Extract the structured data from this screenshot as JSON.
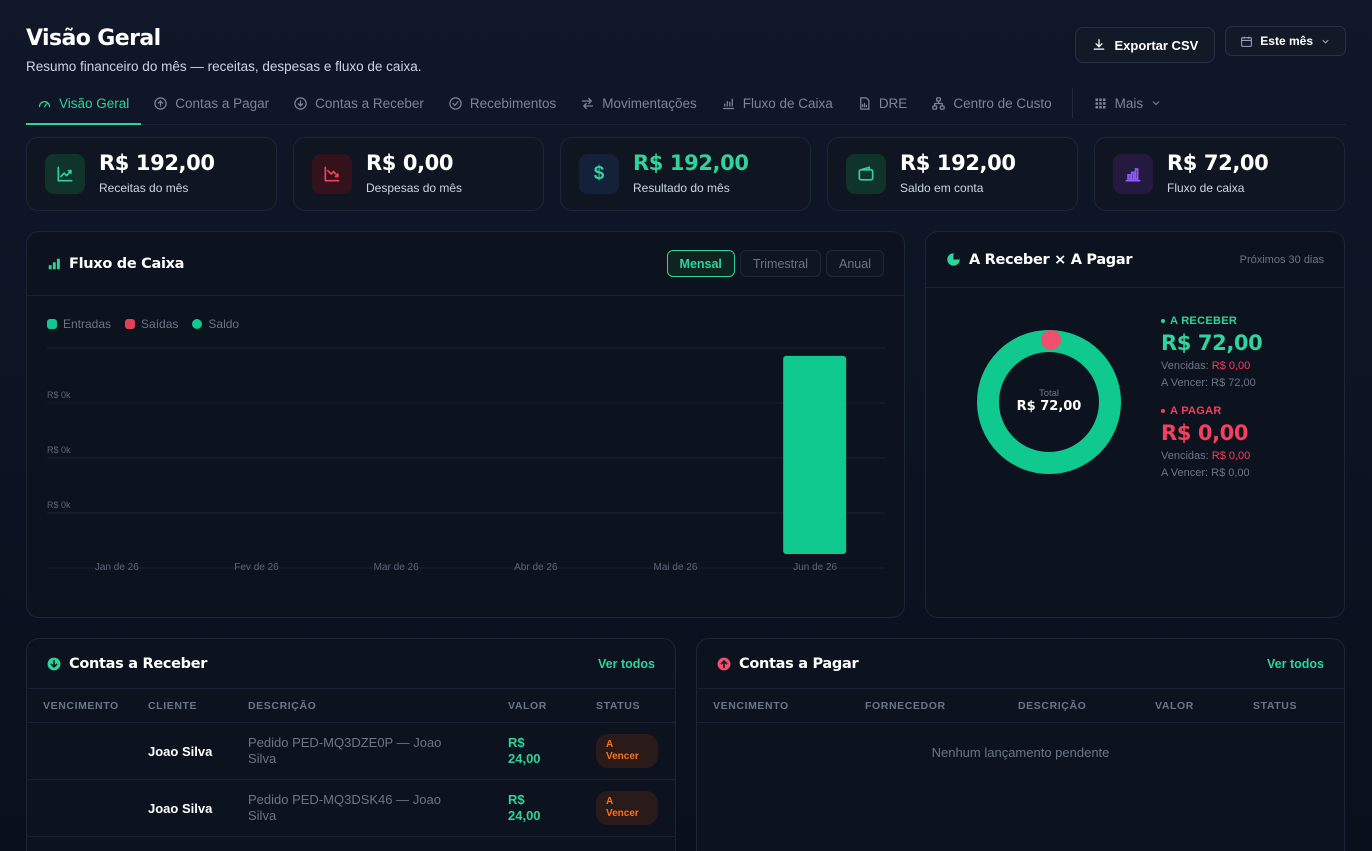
{
  "header": {
    "title": "Visão Geral",
    "subtitle": "Resumo financeiro do mês — receitas, despesas e fluxo de caixa.",
    "export_label": "Exportar CSV",
    "period_label": "Este mês"
  },
  "tabs": [
    {
      "label": "Visão Geral",
      "icon": "gauge-icon"
    },
    {
      "label": "Contas a Pagar",
      "icon": "arrow-up-circle-icon"
    },
    {
      "label": "Contas a Receber",
      "icon": "arrow-down-circle-icon"
    },
    {
      "label": "Recebimentos",
      "icon": "check-circle-icon"
    },
    {
      "label": "Movimentações",
      "icon": "swap-arrows-icon"
    },
    {
      "label": "Fluxo de Caixa",
      "icon": "bar-chart-icon"
    },
    {
      "label": "DRE",
      "icon": "document-chart-icon"
    },
    {
      "label": "Centro de Custo",
      "icon": "org-chart-icon"
    },
    {
      "label": "Mais",
      "icon": "grid-icon"
    }
  ],
  "kpis": [
    {
      "value": "R$ 192,00",
      "label": "Receitas do mês",
      "icon": "trend-up-icon",
      "color": "#2fd39b"
    },
    {
      "value": "R$ 0,00",
      "label": "Despesas do mês",
      "icon": "trend-down-icon",
      "color": "#f43f5e"
    },
    {
      "value": "R$ 192,00",
      "label": "Resultado do mês",
      "icon": "dollar-icon",
      "color": "#2fd39b"
    },
    {
      "value": "R$ 192,00",
      "label": "Saldo em conta",
      "icon": "wallet-icon",
      "color": "#2fd39b"
    },
    {
      "value": "R$ 72,00",
      "label": "Fluxo de caixa",
      "icon": "bar-chart-icon",
      "color": "#8b5cf6"
    }
  ],
  "cashflow": {
    "title": "Fluxo de Caixa",
    "periods": [
      "Mensal",
      "Trimestral",
      "Anual"
    ],
    "active_period": "Mensal",
    "legend": [
      {
        "name": "Entradas",
        "color": "#10c98f"
      },
      {
        "name": "Saídas",
        "color": "#e0405a"
      },
      {
        "name": "Saldo",
        "color": "#10c98f"
      }
    ]
  },
  "chart_data": {
    "type": "bar",
    "categories": [
      "Jan de 26",
      "Fev de 26",
      "Mar de 26",
      "Abr de 26",
      "Mai de 26",
      "Jun de 26"
    ],
    "series": [
      {
        "name": "Entradas",
        "values": [
          0,
          0,
          0,
          0,
          0,
          192
        ]
      },
      {
        "name": "Saídas",
        "values": [
          0,
          0,
          0,
          0,
          0,
          0
        ]
      }
    ],
    "y_tick_labels": [
      "R$ 0k",
      "R$ 0k",
      "R$ 0k"
    ],
    "ylim": [
      0,
      210
    ],
    "grid": true,
    "legend_position": "top-left"
  },
  "receivables_vs_payables": {
    "title": "A Receber × A Pagar",
    "range_label": "Próximos 30 dias",
    "total_label": "Total",
    "total_value": "R$ 72,00",
    "receber": {
      "label": "A RECEBER",
      "value": "R$ 72,00",
      "overdue_label": "Vencidas:",
      "overdue_value": "R$ 0,00",
      "upcoming": "A Vencer: R$ 72,00",
      "color": "#2fd39b",
      "amount": 72
    },
    "pagar": {
      "label": "A PAGAR",
      "value": "R$ 0,00",
      "overdue_label": "Vencidas:",
      "overdue_value": "R$ 0,00",
      "upcoming": "A Vencer: R$ 0,00",
      "color": "#f43f5e",
      "amount": 0
    }
  },
  "receivables": {
    "title": "Contas a Receber",
    "link": "Ver todos",
    "columns": [
      "VENCIMENTO",
      "CLIENTE",
      "DESCRIÇÃO",
      "VALOR",
      "STATUS"
    ],
    "rows": [
      {
        "due": "",
        "client": "Joao Silva",
        "description": "Pedido PED-MQ3DZE0P — Joao Silva",
        "value": "R$ 24,00",
        "status": "A Vencer"
      },
      {
        "due": "",
        "client": "Joao Silva",
        "description": "Pedido PED-MQ3DSK46 — Joao Silva",
        "value": "R$ 24,00",
        "status": "A Vencer"
      }
    ]
  },
  "payables": {
    "title": "Contas a Pagar",
    "link": "Ver todos",
    "columns": [
      "VENCIMENTO",
      "FORNECEDOR",
      "DESCRIÇÃO",
      "VALOR",
      "STATUS"
    ],
    "empty_message": "Nenhum lançamento pendente"
  }
}
